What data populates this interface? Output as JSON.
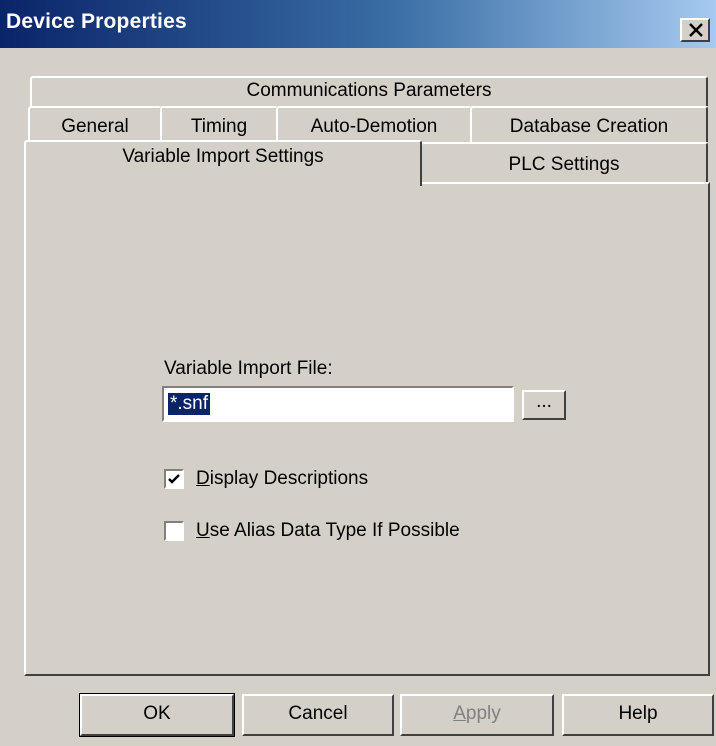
{
  "window": {
    "title": "Device Properties",
    "close_label": "×"
  },
  "tabs": {
    "row1": [
      "Communications Parameters"
    ],
    "row2": [
      "General",
      "Timing",
      "Auto-Demotion",
      "Database Creation"
    ],
    "row3": [
      "Variable Import Settings",
      "PLC Settings"
    ],
    "active": "Variable Import Settings"
  },
  "form": {
    "file_label": "Variable Import File:",
    "file_value": "*.snf",
    "browse_label": "...",
    "display_descriptions": {
      "label_hotkey": "D",
      "label_rest": "isplay Descriptions",
      "checked": true
    },
    "use_alias": {
      "label_hotkey": "U",
      "label_rest": "se Alias Data Type If Possible",
      "checked": false
    }
  },
  "buttons": {
    "ok": "OK",
    "cancel": "Cancel",
    "apply_hotkey": "A",
    "apply_rest": "pply",
    "help": "Help"
  },
  "colors": {
    "title_gradient_start": "#0a246a",
    "title_gradient_end": "#a6caf0",
    "dialog_face": "#d4d0c8",
    "selection": "#0a246a"
  }
}
